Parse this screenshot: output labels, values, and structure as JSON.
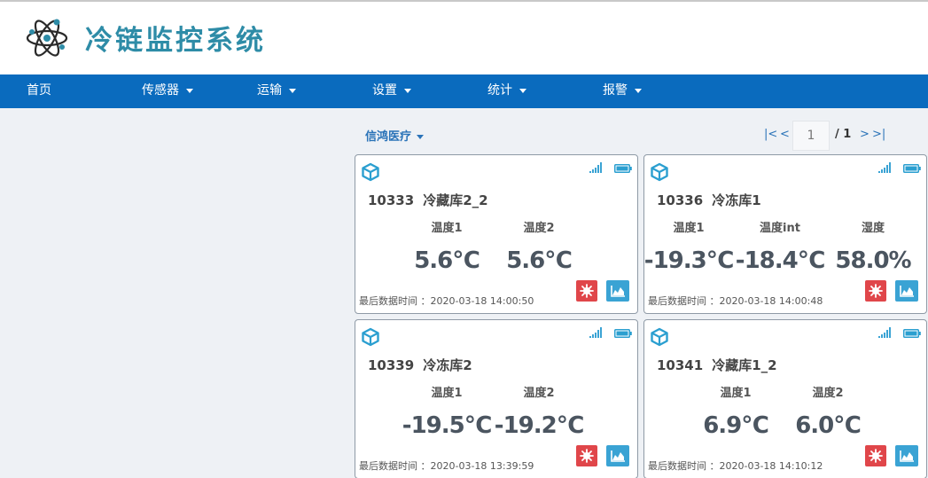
{
  "app": {
    "title": "冷链监控系统"
  },
  "nav": [
    {
      "label": "首页",
      "dropdown": false
    },
    {
      "label": "传感器",
      "dropdown": true
    },
    {
      "label": "运输",
      "dropdown": true
    },
    {
      "label": "设置",
      "dropdown": true
    },
    {
      "label": "统计",
      "dropdown": true
    },
    {
      "label": "报警",
      "dropdown": true
    }
  ],
  "org": {
    "selected": "信鸿医疗"
  },
  "pager": {
    "first": "|<",
    "prev": "<",
    "current": "1",
    "total": "/ 1",
    "next": ">",
    "last": ">|"
  },
  "last_time_label": "最后数据时间 ：",
  "icons": {
    "device": "cube-icon",
    "signal": "signal-icon",
    "battery": "battery-icon",
    "alarm": "alarm-icon",
    "chart": "chart-icon"
  },
  "colors": {
    "brand": "#2e8ca7",
    "nav_bg": "#0a6bbe",
    "alarm": "#e0464a",
    "chart": "#3aa3d4"
  },
  "devices": [
    {
      "id": "10333",
      "name": "冷藏库2_2",
      "sensors": [
        {
          "label": "温度1",
          "value": "5.6℃"
        },
        {
          "label": "温度2",
          "value": "5.6℃"
        }
      ],
      "last_time": "2020-03-18 14:00:50"
    },
    {
      "id": "10336",
      "name": "冷冻库1",
      "sensors": [
        {
          "label": "温度1",
          "value": "-19.3℃"
        },
        {
          "label": "温度int",
          "value": "-18.4℃"
        },
        {
          "label": "湿度",
          "value": "58.0%"
        }
      ],
      "last_time": "2020-03-18 14:00:48"
    },
    {
      "id": "10339",
      "name": "冷冻库2",
      "sensors": [
        {
          "label": "温度1",
          "value": "-19.5℃"
        },
        {
          "label": "温度2",
          "value": "-19.2℃"
        }
      ],
      "last_time": "2020-03-18 13:39:59"
    },
    {
      "id": "10341",
      "name": "冷藏库1_2",
      "sensors": [
        {
          "label": "温度1",
          "value": "6.9℃"
        },
        {
          "label": "温度2",
          "value": "6.0℃"
        }
      ],
      "last_time": "2020-03-18 14:10:12"
    }
  ]
}
